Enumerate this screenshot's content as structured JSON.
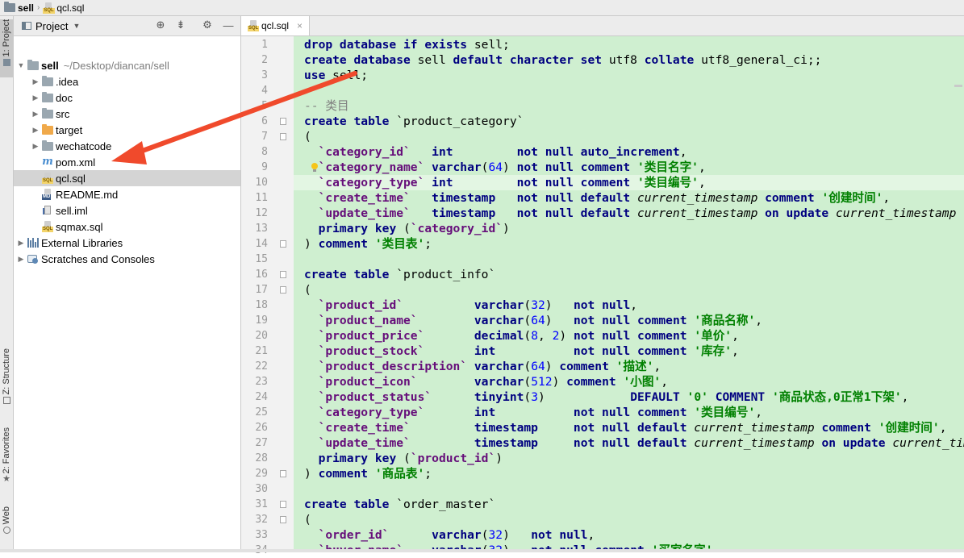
{
  "breadcrumb": {
    "project": "sell",
    "file": "qcl.sql"
  },
  "left_stripe": {
    "project_tab": "1: Project",
    "structure_tab": "Z: Structure",
    "favorites_tab": "2: Favorites",
    "web_tab": "Web"
  },
  "project_panel": {
    "view_label": "Project",
    "tree": [
      {
        "label": "sell",
        "path": "~/Desktop/diancan/sell",
        "icon": "folder-icon"
      },
      {
        "label": ".idea",
        "icon": "folder-icon"
      },
      {
        "label": "doc",
        "icon": "folder-icon"
      },
      {
        "label": "src",
        "icon": "folder-icon"
      },
      {
        "label": "target",
        "icon": "folder-orange-icon"
      },
      {
        "label": "wechatcode",
        "icon": "folder-icon"
      },
      {
        "label": "pom.xml",
        "icon": "maven-icon"
      },
      {
        "label": "qcl.sql",
        "icon": "sql-file-icon",
        "selected": true
      },
      {
        "label": "README.md",
        "icon": "markdown-icon"
      },
      {
        "label": "sell.iml",
        "icon": "iml-icon"
      },
      {
        "label": "sqmax.sql",
        "icon": "sql-file-icon"
      },
      {
        "label": "External Libraries",
        "icon": "library-icon"
      },
      {
        "label": "Scratches and Consoles",
        "icon": "scratch-icon"
      }
    ]
  },
  "editor": {
    "tab_label": "qcl.sql",
    "close_glyph": "×",
    "line_numbers": [
      "1",
      "2",
      "3",
      "4",
      "5",
      "6",
      "7",
      "8",
      "9",
      "10",
      "11",
      "12",
      "13",
      "14",
      "15",
      "16",
      "17",
      "18",
      "19",
      "20",
      "21",
      "22",
      "23",
      "24",
      "25",
      "26",
      "27",
      "28",
      "29",
      "30",
      "31",
      "32",
      "33",
      "34"
    ],
    "colors": {
      "keyword": "#000080",
      "identifier": "#660e7a",
      "string": "#008000",
      "number": "#0000ff",
      "comment": "#808080",
      "background": "#cfefd0"
    }
  },
  "code_lines": [
    [
      [
        "kw",
        "drop database if exists "
      ],
      [
        "",
        "sell;"
      ]
    ],
    [
      [
        "kw",
        "create database "
      ],
      [
        "",
        "sell "
      ],
      [
        "kw",
        "default character set "
      ],
      [
        "",
        "utf8 "
      ],
      [
        "kw",
        "collate "
      ],
      [
        "",
        "utf8_general_ci;;"
      ]
    ],
    [
      [
        "kw",
        "use "
      ],
      [
        "",
        "sell;"
      ]
    ],
    [],
    [
      [
        "cm",
        "-- 类目"
      ]
    ],
    [
      [
        "kw",
        "create table "
      ],
      [
        "",
        "`product_category`"
      ]
    ],
    [
      [
        "",
        "("
      ]
    ],
    [
      [
        "",
        "  "
      ],
      [
        "id",
        "`category_id`"
      ],
      [
        "",
        "   "
      ],
      [
        "kw",
        "int"
      ],
      [
        "",
        "         "
      ],
      [
        "kw",
        "not null auto_increment"
      ],
      [
        "",
        ","
      ]
    ],
    [
      [
        "",
        "  "
      ],
      [
        "id",
        "`category_name`"
      ],
      [
        "",
        ""
      ],
      [
        "kw",
        " varchar"
      ],
      [
        "",
        "("
      ],
      [
        "num",
        "64"
      ],
      [
        "",
        ") "
      ],
      [
        "kw",
        "not null comment "
      ],
      [
        "str",
        "'类目名字'"
      ],
      [
        "",
        ","
      ]
    ],
    [
      [
        "",
        "  "
      ],
      [
        "id",
        "`category_type`"
      ],
      [
        "",
        ""
      ],
      [
        "kw",
        " int"
      ],
      [
        "",
        "         "
      ],
      [
        "kw",
        "not null comment "
      ],
      [
        "str",
        "'类目编号'"
      ],
      [
        "",
        ","
      ]
    ],
    [
      [
        "",
        "  "
      ],
      [
        "id",
        "`create_time`"
      ],
      [
        "",
        "   "
      ],
      [
        "kw",
        "timestamp"
      ],
      [
        "",
        "   "
      ],
      [
        "kw",
        "not null default "
      ],
      [
        "it",
        "current_timestamp "
      ],
      [
        "kw",
        "comment "
      ],
      [
        "str",
        "'创建时间'"
      ],
      [
        "",
        ","
      ]
    ],
    [
      [
        "",
        "  "
      ],
      [
        "id",
        "`update_time`"
      ],
      [
        "",
        "   "
      ],
      [
        "kw",
        "timestamp"
      ],
      [
        "",
        "   "
      ],
      [
        "kw",
        "not null default "
      ],
      [
        "it",
        "current_timestamp "
      ],
      [
        "kw",
        "on update "
      ],
      [
        "it",
        "current_timestamp"
      ]
    ],
    [
      [
        "",
        "  "
      ],
      [
        "kw",
        "primary key "
      ],
      [
        "",
        "("
      ],
      [
        "id",
        "`category_id`"
      ],
      [
        "",
        ")"
      ]
    ],
    [
      [
        "",
        ") "
      ],
      [
        "kw",
        "comment "
      ],
      [
        "str",
        "'类目表'"
      ],
      [
        "",
        ";"
      ]
    ],
    [],
    [
      [
        "kw",
        "create table "
      ],
      [
        "",
        "`product_info`"
      ]
    ],
    [
      [
        "",
        "("
      ]
    ],
    [
      [
        "",
        "  "
      ],
      [
        "id",
        "`product_id`"
      ],
      [
        "",
        "          "
      ],
      [
        "kw",
        "varchar"
      ],
      [
        "",
        "("
      ],
      [
        "num",
        "32"
      ],
      [
        "",
        ")   "
      ],
      [
        "kw",
        "not null"
      ],
      [
        "",
        ","
      ]
    ],
    [
      [
        "",
        "  "
      ],
      [
        "id",
        "`product_name`"
      ],
      [
        "",
        "        "
      ],
      [
        "kw",
        "varchar"
      ],
      [
        "",
        "("
      ],
      [
        "num",
        "64"
      ],
      [
        "",
        ")   "
      ],
      [
        "kw",
        "not null comment "
      ],
      [
        "str",
        "'商品名称'"
      ],
      [
        "",
        ","
      ]
    ],
    [
      [
        "",
        "  "
      ],
      [
        "id",
        "`product_price`"
      ],
      [
        "",
        "       "
      ],
      [
        "kw",
        "decimal"
      ],
      [
        "",
        "("
      ],
      [
        "num",
        "8"
      ],
      [
        "",
        ", "
      ],
      [
        "num",
        "2"
      ],
      [
        "",
        ") "
      ],
      [
        "kw",
        "not null comment "
      ],
      [
        "str",
        "'单价'"
      ],
      [
        "",
        ","
      ]
    ],
    [
      [
        "",
        "  "
      ],
      [
        "id",
        "`product_stock`"
      ],
      [
        "",
        "       "
      ],
      [
        "kw",
        "int"
      ],
      [
        "",
        "           "
      ],
      [
        "kw",
        "not null comment "
      ],
      [
        "str",
        "'库存'"
      ],
      [
        "",
        ","
      ]
    ],
    [
      [
        "",
        "  "
      ],
      [
        "id",
        "`product_description`"
      ],
      [
        "",
        " "
      ],
      [
        "kw",
        "varchar"
      ],
      [
        "",
        "("
      ],
      [
        "num",
        "64"
      ],
      [
        "",
        ") "
      ],
      [
        "kw",
        "comment "
      ],
      [
        "str",
        "'描述'"
      ],
      [
        "",
        ","
      ]
    ],
    [
      [
        "",
        "  "
      ],
      [
        "id",
        "`product_icon`"
      ],
      [
        "",
        "        "
      ],
      [
        "kw",
        "varchar"
      ],
      [
        "",
        "("
      ],
      [
        "num",
        "512"
      ],
      [
        "",
        ") "
      ],
      [
        "kw",
        "comment "
      ],
      [
        "str",
        "'小图'"
      ],
      [
        "",
        ","
      ]
    ],
    [
      [
        "",
        "  "
      ],
      [
        "id",
        "`product_status`"
      ],
      [
        "",
        "      "
      ],
      [
        "kw",
        "tinyint"
      ],
      [
        "",
        "("
      ],
      [
        "num",
        "3"
      ],
      [
        "",
        ")            "
      ],
      [
        "kw",
        "DEFAULT "
      ],
      [
        "str",
        "'0' "
      ],
      [
        "kw",
        "COMMENT "
      ],
      [
        "str",
        "'商品状态,0正常1下架'"
      ],
      [
        "",
        ","
      ]
    ],
    [
      [
        "",
        "  "
      ],
      [
        "id",
        "`category_type`"
      ],
      [
        "",
        "       "
      ],
      [
        "kw",
        "int"
      ],
      [
        "",
        "           "
      ],
      [
        "kw",
        "not null comment "
      ],
      [
        "str",
        "'类目编号'"
      ],
      [
        "",
        ","
      ]
    ],
    [
      [
        "",
        "  "
      ],
      [
        "id",
        "`create_time`"
      ],
      [
        "",
        "         "
      ],
      [
        "kw",
        "timestamp"
      ],
      [
        "",
        "     "
      ],
      [
        "kw",
        "not null default "
      ],
      [
        "it",
        "current_timestamp "
      ],
      [
        "kw",
        "comment "
      ],
      [
        "str",
        "'创建时间'"
      ],
      [
        "",
        ","
      ]
    ],
    [
      [
        "",
        "  "
      ],
      [
        "id",
        "`update_time`"
      ],
      [
        "",
        "         "
      ],
      [
        "kw",
        "timestamp"
      ],
      [
        "",
        "     "
      ],
      [
        "kw",
        "not null default "
      ],
      [
        "it",
        "current_timestamp "
      ],
      [
        "kw",
        "on update "
      ],
      [
        "it",
        "current_timestamp"
      ]
    ],
    [
      [
        "",
        "  "
      ],
      [
        "kw",
        "primary key "
      ],
      [
        "",
        "("
      ],
      [
        "id",
        "`product_id`"
      ],
      [
        "",
        ")"
      ]
    ],
    [
      [
        "",
        ") "
      ],
      [
        "kw",
        "comment "
      ],
      [
        "str",
        "'商品表'"
      ],
      [
        "",
        ";"
      ]
    ],
    [],
    [
      [
        "kw",
        "create table "
      ],
      [
        "",
        "`order_master`"
      ]
    ],
    [
      [
        "",
        "("
      ]
    ],
    [
      [
        "",
        "  "
      ],
      [
        "id",
        "`order_id`"
      ],
      [
        "",
        "      "
      ],
      [
        "kw",
        "varchar"
      ],
      [
        "",
        "("
      ],
      [
        "num",
        "32"
      ],
      [
        "",
        ")   "
      ],
      [
        "kw",
        "not null"
      ],
      [
        "",
        ","
      ]
    ],
    [
      [
        "",
        "  "
      ],
      [
        "id",
        "`buyer_name`"
      ],
      [
        "",
        "    "
      ],
      [
        "kw",
        "varchar"
      ],
      [
        "",
        "("
      ],
      [
        "num",
        "32"
      ],
      [
        "",
        ")   "
      ],
      [
        "kw",
        "not null comment "
      ],
      [
        "str",
        "'买家名字'"
      ],
      [
        "",
        ","
      ]
    ]
  ]
}
